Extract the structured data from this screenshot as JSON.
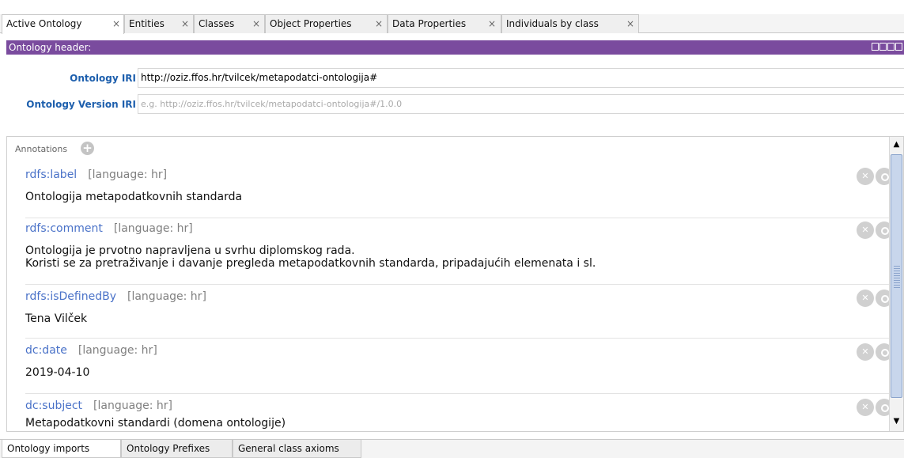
{
  "top_tabs": [
    {
      "label": "Active Ontology"
    },
    {
      "label": "Entities"
    },
    {
      "label": "Classes"
    },
    {
      "label": "Object Properties"
    },
    {
      "label": "Data Properties"
    },
    {
      "label": "Individuals by class"
    }
  ],
  "tab_close_glyph": "×",
  "header": {
    "title": "Ontology header:",
    "iri_label": "Ontology IRI",
    "iri_value": "http://oziz.ffos.hr/tvilcek/metapodatci-ontologija#",
    "version_label": "Ontology Version IRI",
    "version_placeholder": "e.g. http://oziz.ffos.hr/tvilcek/metapodatci-ontologija#/1.0.0"
  },
  "annotations": {
    "title": "Annotations",
    "add_glyph": "+",
    "items": [
      {
        "property": "rdfs:label",
        "language": "[language: hr]",
        "value": "Ontologija metapodatkovnih standarda"
      },
      {
        "property": "rdfs:comment",
        "language": "[language: hr]",
        "value": "Ontologija je prvotno napravljena u svrhu diplomskog rada.\nKoristi se za pretraživanje i davanje pregleda metapodatkovnih standarda, pripadajućih elemenata i sl."
      },
      {
        "property": "rdfs:isDefinedBy",
        "language": "[language: hr]",
        "value": "Tena Vilček"
      },
      {
        "property": "dc:date",
        "language": "[language: hr]",
        "value": "2019-04-10"
      },
      {
        "property": "dc:subject",
        "language": "[language: hr]",
        "value": "Metapodatkovni standardi (domena ontologije)"
      }
    ]
  },
  "scroll": {
    "up": "▲",
    "down": "▼"
  },
  "bottom_tabs": [
    {
      "label": "Ontology imports"
    },
    {
      "label": "Ontology Prefixes"
    },
    {
      "label": "General class axioms"
    }
  ],
  "colors": {
    "view_header": "#7a4b9e",
    "link_blue": "#1d5fad",
    "property_blue": "#4a72c8"
  }
}
